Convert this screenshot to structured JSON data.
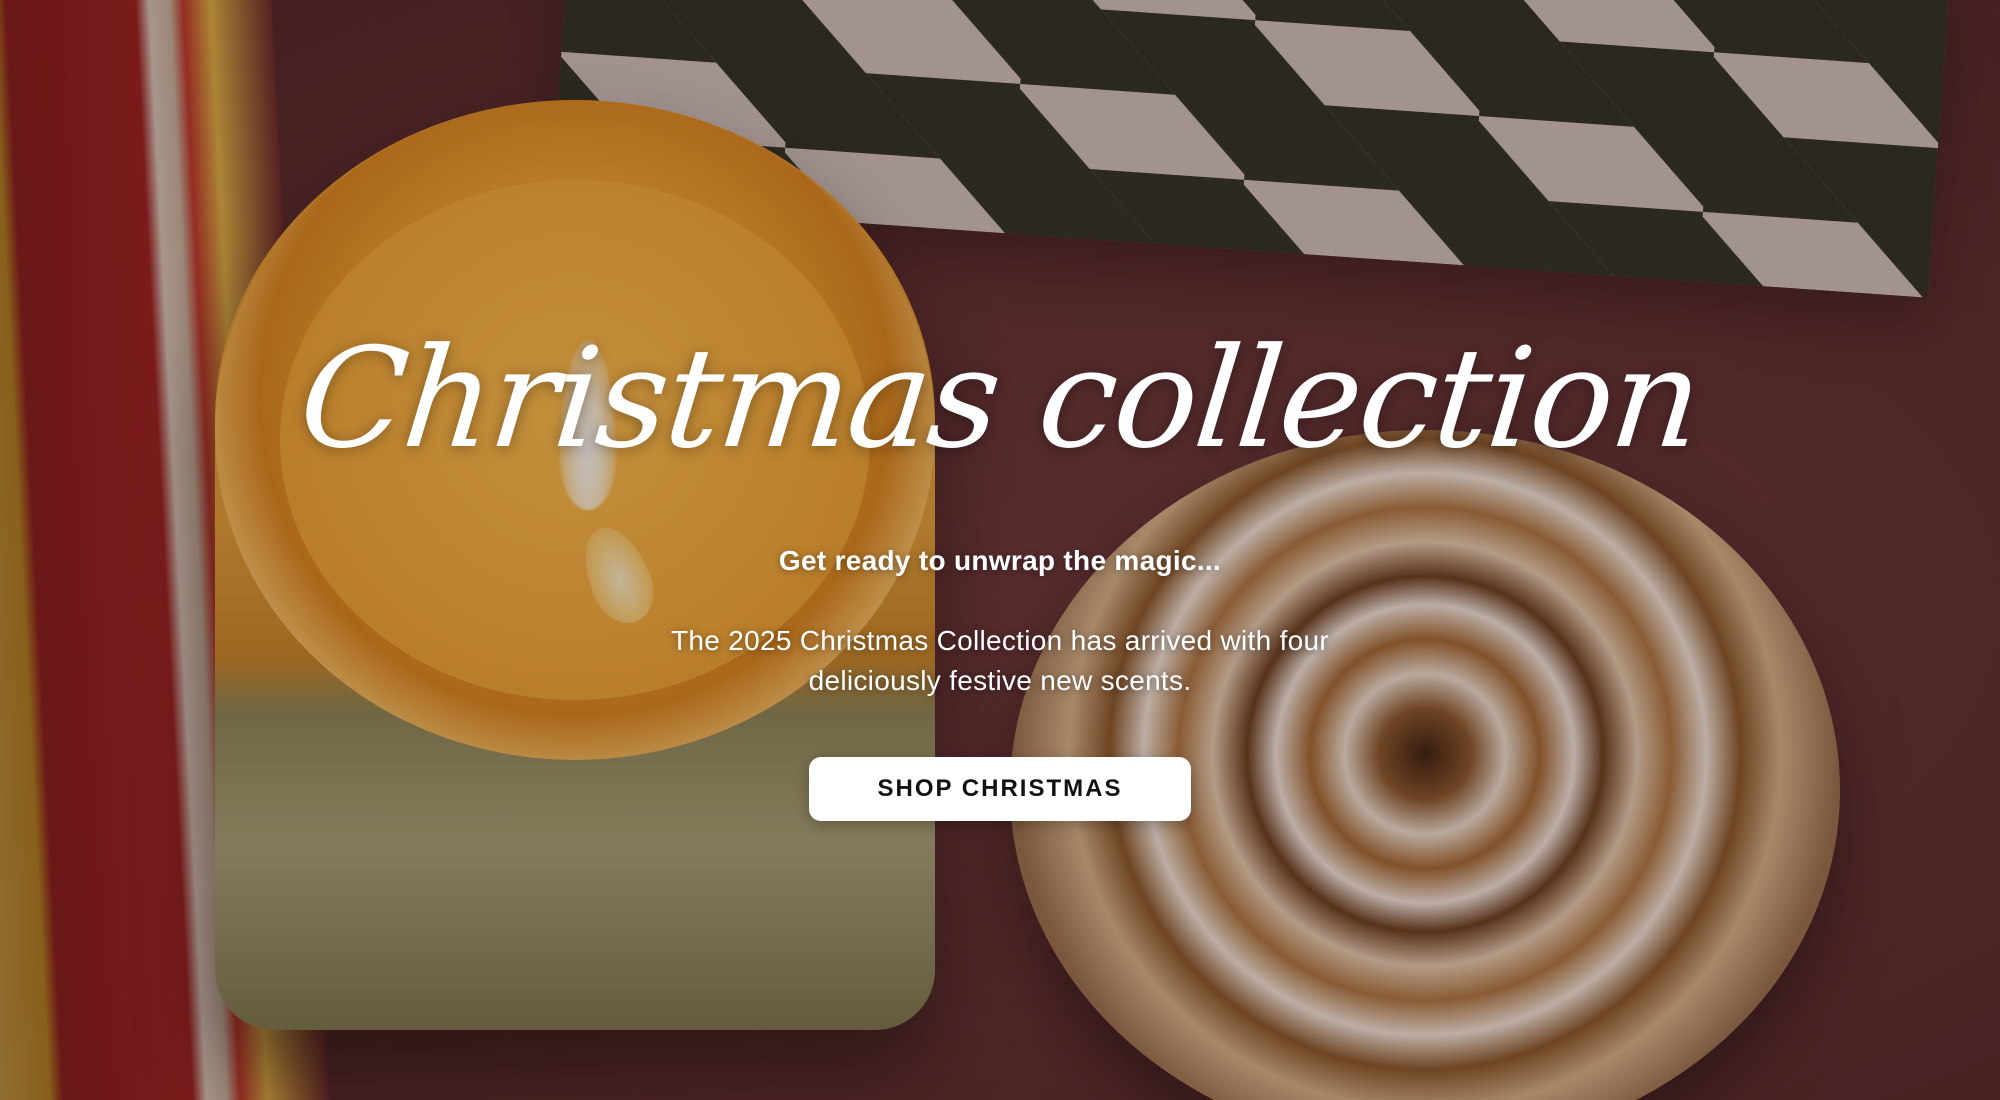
{
  "hero": {
    "title": "Christmas collection",
    "subtitle": "Get ready to unwrap the magic...",
    "description": "The 2025 Christmas Collection has arrived with four deliciously festive new scents.",
    "cta_label": "SHOP CHRISTMAS"
  },
  "colors": {
    "background": "#5c2f31",
    "text": "#ffffff",
    "button_bg": "#ffffff",
    "button_text": "#111111"
  }
}
